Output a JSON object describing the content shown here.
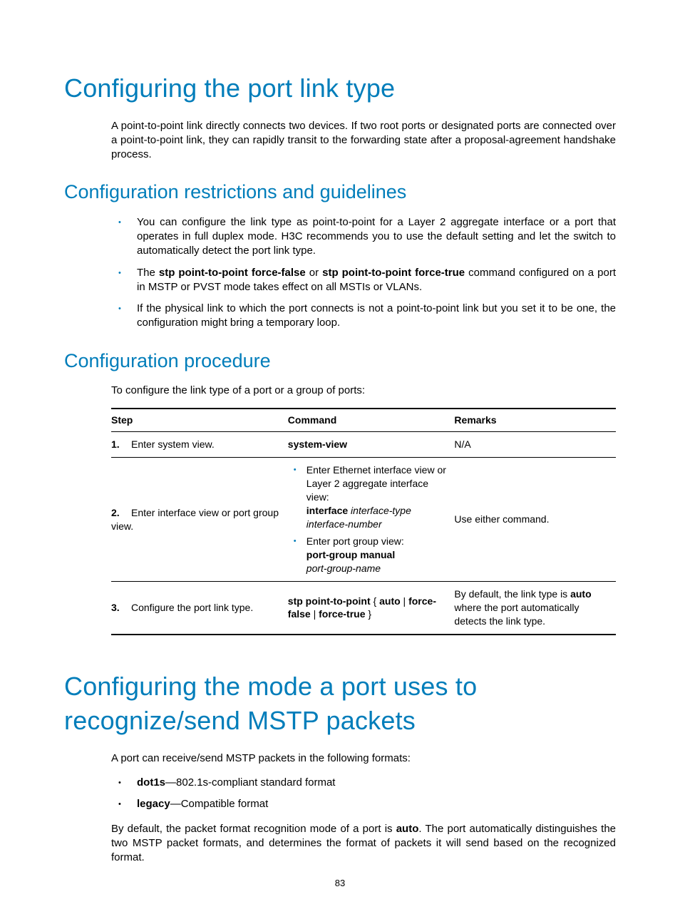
{
  "h1a": "Configuring the port link type",
  "intro": "A point-to-point link directly connects two devices. If two root ports or designated ports are connected over a point-to-point link, they can rapidly transit to the forwarding state after a proposal-agreement handshake process.",
  "h2a": "Configuration restrictions and guidelines",
  "guidelines": {
    "g1": "You can configure the link type as point-to-point for a Layer 2 aggregate interface or a port that operates in full duplex mode. H3C recommends you to use the default setting and let the switch to automatically detect the port link type.",
    "g2_pre": "The ",
    "g2_b1": "stp point-to-point force-false",
    "g2_mid": " or ",
    "g2_b2": "stp point-to-point force-true",
    "g2_post": " command configured on a port in MSTP or PVST mode takes effect on all MSTIs or VLANs.",
    "g3": "If the physical link to which the port connects is not a point-to-point link but you set it to be one, the configuration might bring a temporary loop."
  },
  "h2b": "Configuration procedure",
  "proc_intro": "To configure the link type of a port or a group of ports:",
  "table": {
    "head": {
      "step": "Step",
      "cmd": "Command",
      "rem": "Remarks"
    },
    "r1": {
      "num": "1.",
      "desc": "Enter system view.",
      "cmd": "system-view",
      "rem": "N/A"
    },
    "r2": {
      "num": "2.",
      "desc": "Enter interface view or port group view.",
      "cmd_a1": "Enter Ethernet interface view or Layer 2 aggregate interface view:",
      "cmd_a2a": "interface",
      "cmd_a2b": "interface-type interface-number",
      "cmd_b1": "Enter port group view:",
      "cmd_b2a": "port-group manual",
      "cmd_b2b": "port-group-name",
      "rem": "Use either command."
    },
    "r3": {
      "num": "3.",
      "desc": "Configure the port link type.",
      "cmd_a": "stp point-to-point",
      "cmd_b": "auto",
      "cmd_c": "force-false",
      "cmd_d": "force-true",
      "rem_pre": "By default, the link type is ",
      "rem_b": "auto",
      "rem_post": " where the port automatically detects the link type."
    }
  },
  "h1b": "Configuring the mode a port uses to recognize/send MSTP packets",
  "mstp_intro": "A port can receive/send MSTP packets in the following formats:",
  "mstp": {
    "a_b": "dot1s",
    "a_t": "—802.1s-compliant standard format",
    "b_b": "legacy",
    "b_t": "—Compatible format"
  },
  "mstp_para_pre": "By default, the packet format recognition mode of a port is ",
  "mstp_para_b": "auto",
  "mstp_para_post": ". The port automatically distinguishes the two MSTP packet formats, and determines the format of packets it will send based on the recognized format.",
  "page_number": "83"
}
